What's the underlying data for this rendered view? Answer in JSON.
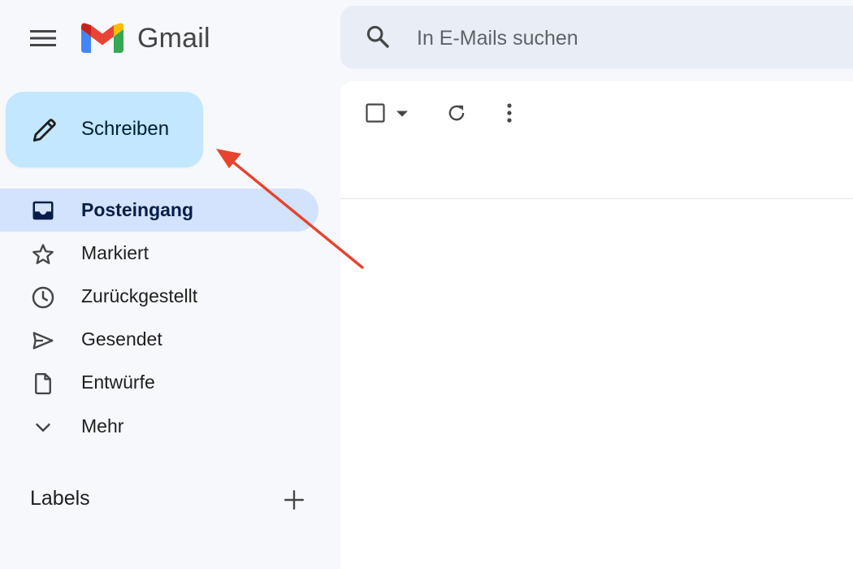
{
  "header": {
    "menu_icon": "hamburger-menu-icon",
    "logo_icon": "gmail-m-logo",
    "brand_name": "Gmail",
    "search": {
      "icon": "search-icon",
      "placeholder": "In E-Mails suchen",
      "value": ""
    }
  },
  "sidebar": {
    "compose": {
      "label": "Schreiben",
      "icon": "pencil-icon",
      "color": "#c2e7ff"
    },
    "items": [
      {
        "label": "Posteingang",
        "icon": "inbox-icon",
        "active": true
      },
      {
        "label": "Markiert",
        "icon": "star-icon"
      },
      {
        "label": "Zurückgestellt",
        "icon": "clock-icon"
      },
      {
        "label": "Gesendet",
        "icon": "send-icon"
      },
      {
        "label": "Entwürfe",
        "icon": "draft-icon"
      },
      {
        "label": "Mehr",
        "icon": "chevron-down-icon"
      }
    ],
    "labels": {
      "title": "Labels",
      "add_icon": "plus-icon"
    }
  },
  "toolbar": {
    "select_icon": "checkbox-icon",
    "select_dropdown_icon": "caret-down-icon",
    "refresh_icon": "refresh-icon",
    "more_icon": "more-vertical-icon"
  },
  "annotation": {
    "arrow_color": "#e8432e",
    "points_to": "compose-button"
  },
  "colors": {
    "background": "#f6f8fc",
    "search_bg": "#e9eef6",
    "active_item_bg": "#d3e3fd",
    "gmail_red": "#ea4335",
    "gmail_blue": "#4285f4",
    "gmail_green": "#34a853",
    "gmail_yellow": "#fbbc04"
  }
}
